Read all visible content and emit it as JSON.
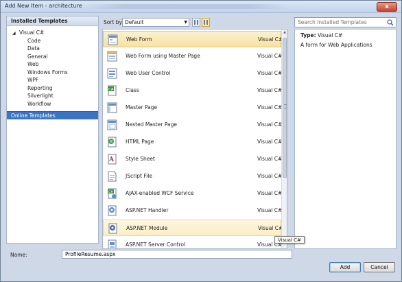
{
  "window": {
    "title": "Add New Item - architecture",
    "close_glyph": "x"
  },
  "installed_header": "Installed Templates",
  "tree": {
    "root": "Visual C#",
    "children": [
      "Code",
      "Data",
      "General",
      "Web",
      "Windows Forms",
      "WPF",
      "Reporting",
      "Silverlight",
      "Workflow"
    ]
  },
  "online_templates": "Online Templates",
  "sort": {
    "label": "Sort by:",
    "value": "Default"
  },
  "search": {
    "placeholder": "Search Installed Templates",
    "icon": "search-icon"
  },
  "templates": [
    {
      "name": "Web Form",
      "lang": "Visual C#",
      "icon": "web-form-icon"
    },
    {
      "name": "Web Form using Master Page",
      "lang": "Visual C#",
      "icon": "web-form-master-icon"
    },
    {
      "name": "Web User Control",
      "lang": "Visual C#",
      "icon": "user-control-icon"
    },
    {
      "name": "Class",
      "lang": "Visual C#",
      "icon": "class-icon"
    },
    {
      "name": "Master Page",
      "lang": "Visual C#",
      "icon": "master-page-icon"
    },
    {
      "name": "Nested Master Page",
      "lang": "Visual C#",
      "icon": "nested-master-icon"
    },
    {
      "name": "HTML Page",
      "lang": "Visual C#",
      "icon": "html-page-icon"
    },
    {
      "name": "Style Sheet",
      "lang": "Visual C#",
      "icon": "style-sheet-icon"
    },
    {
      "name": "JScript File",
      "lang": "Visual C#",
      "icon": "jscript-icon"
    },
    {
      "name": "AJAX-enabled WCF Service",
      "lang": "Visual C#",
      "icon": "wcf-service-icon"
    },
    {
      "name": "ASP.NET Handler",
      "lang": "Visual C#",
      "icon": "handler-icon"
    },
    {
      "name": "ASP.NET Module",
      "lang": "Visual C#",
      "icon": "module-icon"
    },
    {
      "name": "ASP.NET Server Control",
      "lang": "Visual C#",
      "icon": "server-control-icon"
    }
  ],
  "details": {
    "type_label": "Type:",
    "type_value": "Visual C#",
    "description": "A form for Web Applications"
  },
  "tooltip": "Visual C#",
  "name_field": {
    "label": "Name:",
    "value": "ProfileResume.aspx"
  },
  "buttons": {
    "add": "Add",
    "cancel": "Cancel"
  }
}
